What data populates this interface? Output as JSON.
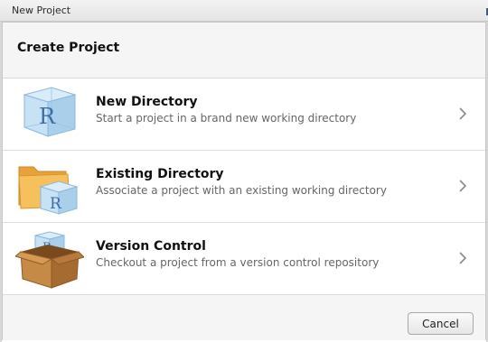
{
  "window": {
    "title": "New Project"
  },
  "header": {
    "title": "Create Project"
  },
  "options": [
    {
      "label": "New Directory",
      "description": "Start a project in a brand new working directory",
      "icon": "r-cube-icon"
    },
    {
      "label": "Existing Directory",
      "description": "Associate a project with an existing working directory",
      "icon": "folder-r-icon"
    },
    {
      "label": "Version Control",
      "description": "Checkout a project from a version control repository",
      "icon": "box-r-icon"
    }
  ],
  "footer": {
    "cancel_label": "Cancel"
  },
  "colors": {
    "accent_blue": "#3b5a8f",
    "cube_blue": "#b9d7ee",
    "folder_orange": "#f3b24a",
    "box_brown": "#b97a3e"
  }
}
